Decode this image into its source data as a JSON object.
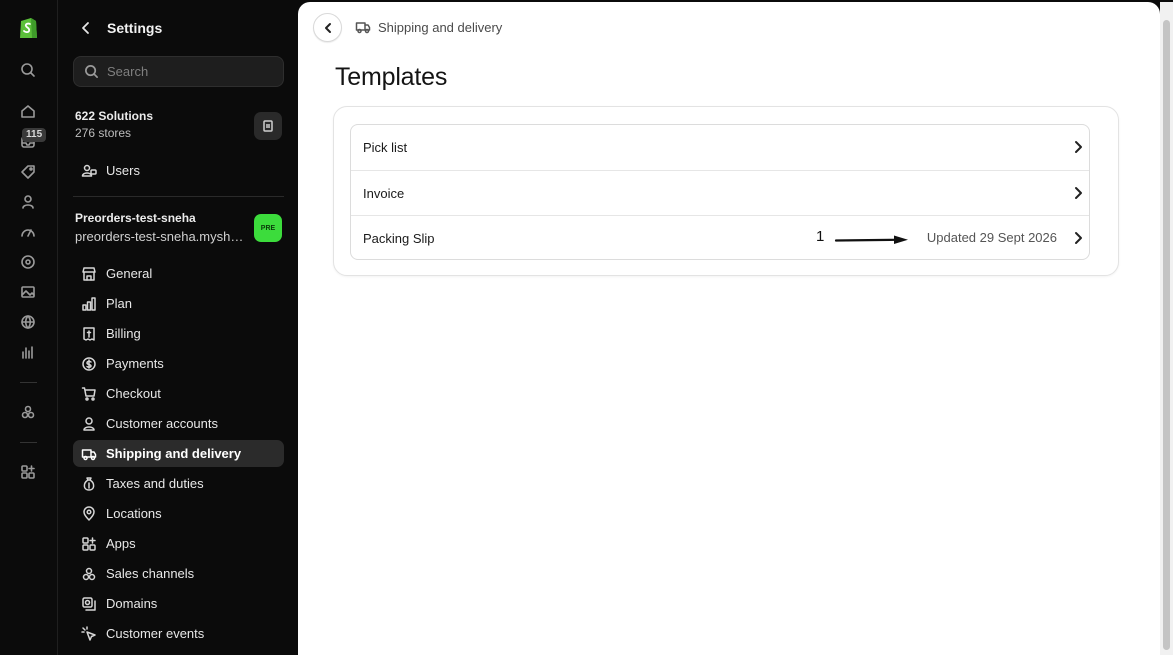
{
  "rail": {
    "badge_count": "115",
    "icons": [
      "home-icon",
      "inbox-icon",
      "tag-icon",
      "person-icon",
      "gauge-icon",
      "target-icon",
      "image-icon",
      "globe-icon",
      "bar-chart-icon",
      "apps-icon",
      "add-app-icon"
    ]
  },
  "sidebar": {
    "title": "Settings",
    "search_placeholder": "Search",
    "org": {
      "name": "622 Solutions",
      "stores": "276 stores"
    },
    "users_label": "Users",
    "store": {
      "name": "Preorders-test-sneha",
      "domain": "preorders-test-sneha.myshopify.com",
      "badge": "PRE"
    },
    "items": [
      {
        "label": "General",
        "icon": "store-icon"
      },
      {
        "label": "Plan",
        "icon": "plan-icon"
      },
      {
        "label": "Billing",
        "icon": "receipt-icon"
      },
      {
        "label": "Payments",
        "icon": "payments-icon"
      },
      {
        "label": "Checkout",
        "icon": "cart-icon"
      },
      {
        "label": "Customer accounts",
        "icon": "person-icon"
      },
      {
        "label": "Shipping and delivery",
        "icon": "truck-icon",
        "active": true
      },
      {
        "label": "Taxes and duties",
        "icon": "money-bag-icon"
      },
      {
        "label": "Locations",
        "icon": "location-icon"
      },
      {
        "label": "Apps",
        "icon": "apps-icon"
      },
      {
        "label": "Sales channels",
        "icon": "channels-icon"
      },
      {
        "label": "Domains",
        "icon": "domains-icon"
      },
      {
        "label": "Customer events",
        "icon": "cursor-icon"
      }
    ]
  },
  "main": {
    "breadcrumb": "Shipping and delivery",
    "title": "Templates",
    "templates": [
      {
        "name": "Pick list",
        "meta": ""
      },
      {
        "name": "Invoice",
        "meta": ""
      },
      {
        "name": "Packing Slip",
        "meta": "Updated 29 Sept 2026"
      }
    ],
    "annotation_number": "1"
  },
  "colors": {
    "accent_green": "#3cdc3c",
    "sidebar_bg": "#0b0b0b",
    "active_item_bg": "#2b2b2b"
  }
}
